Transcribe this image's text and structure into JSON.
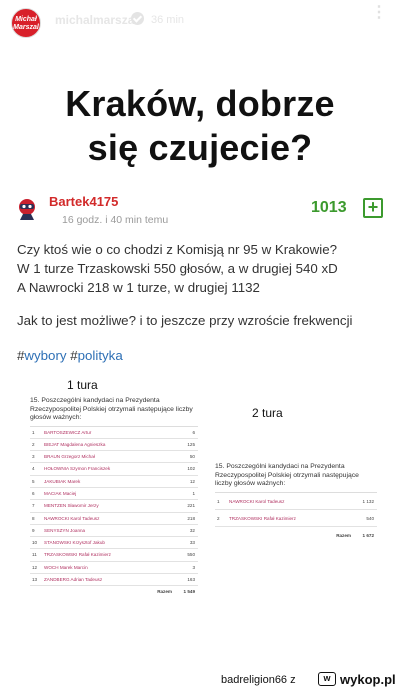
{
  "story": {
    "avatar_text": "Michał Marszal",
    "username": "michalmarszal",
    "time": "36 min",
    "more": "⋮",
    "headline_line1": "Kraków, dobrze",
    "headline_line2": "się czujecie?"
  },
  "post": {
    "author": "Bartek4175",
    "posted": "16 godz. i 40 min temu",
    "votes": "1013",
    "plus": "+",
    "line1": "Czy ktoś wie o co chodzi z Komisją nr 95 w Krakowie?",
    "line2": "W 1 turze Trzaskowski 550 głosów, a w drugiej 540 xD",
    "line3": "A Nawrocki 218 w 1 turze, w drugiej 1132",
    "line4": "Jak to jest możliwe? i to jeszcze przy wzroście frekwencji",
    "tag_prefix": "#",
    "tag1": "wybory",
    "tag2": "polityka"
  },
  "round1": {
    "label": "1 tura",
    "title": "15. Poszczególni kandydaci na Prezydenta Rzeczypospolitej Polskiej otrzymali następujące liczby głosów ważnych:",
    "rows": [
      {
        "n": "1",
        "name": "BARTOSZEWICZ Artur",
        "v": "6"
      },
      {
        "n": "2",
        "name": "BIEJAT Magdalena Agnieszka",
        "v": "125"
      },
      {
        "n": "3",
        "name": "BRAUN Grzegorz Michał",
        "v": "50"
      },
      {
        "n": "4",
        "name": "HOŁOWNIA Szymon Franciszek",
        "v": "102"
      },
      {
        "n": "5",
        "name": "JAKUBIAK Marek",
        "v": "12"
      },
      {
        "n": "6",
        "name": "MACIAK Maciej",
        "v": "1"
      },
      {
        "n": "7",
        "name": "MENTZEN Sławomir Jerzy",
        "v": "221"
      },
      {
        "n": "8",
        "name": "NAWROCKI Karol Tadeusz",
        "v": "218"
      },
      {
        "n": "9",
        "name": "SENYSZYN Joanna",
        "v": "32"
      },
      {
        "n": "10",
        "name": "STANOWSKI Krzysztof Jakub",
        "v": "33"
      },
      {
        "n": "11",
        "name": "TRZASKOWSKI Rafał Kazimierz",
        "v": "550"
      },
      {
        "n": "12",
        "name": "WOCH Marek Marcin",
        "v": "3"
      },
      {
        "n": "13",
        "name": "ZANDBERG Adrian Tadeusz",
        "v": "163"
      }
    ],
    "sum_label": "Razem",
    "sum_value": "1 549"
  },
  "round2": {
    "label": "2 tura",
    "title": "15. Poszczególni kandydaci na Prezydenta Rzeczypospolitej Polskiej otrzymali następujące liczby głosów ważnych:",
    "rows": [
      {
        "n": "1",
        "name": "NAWROCKI Karol Tadeusz",
        "v": "1 132"
      },
      {
        "n": "2",
        "name": "TRZASKOWSKI Rafał Kazimierz",
        "v": "540"
      }
    ],
    "sum_label": "Razem",
    "sum_value": "1 672"
  },
  "footer": {
    "credit": "badreligion66  z",
    "logo_mark": "w",
    "logo_text": "wykop.pl"
  },
  "colors": {
    "accent_red": "#d22a2a",
    "vote_green": "#3c9a2e",
    "tag_blue": "#2d6fb5"
  }
}
